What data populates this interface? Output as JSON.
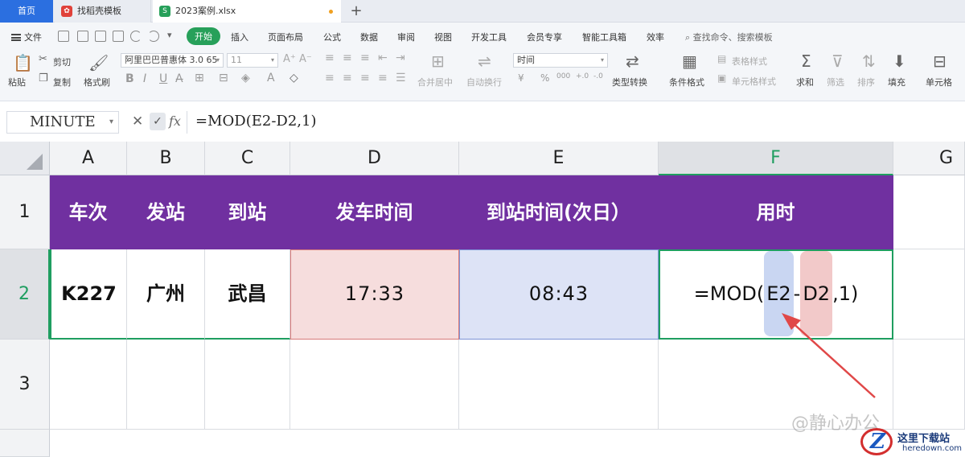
{
  "tabs": {
    "home": "首页",
    "template": "找稻壳模板",
    "file": "2023案例.xlsx",
    "add": "+"
  },
  "menu": {
    "file": "文件",
    "items": [
      "开始",
      "插入",
      "页面布局",
      "公式",
      "数据",
      "审阅",
      "视图",
      "开发工具",
      "会员专享",
      "智能工具箱",
      "效率"
    ],
    "active": "开始",
    "search": "查找命令、搜索模板"
  },
  "ribbon": {
    "paste": "粘贴",
    "cut": "剪切",
    "copy": "复制",
    "format_painter": "格式刷",
    "font_name": "阿里巴巴普惠体 3.0 65",
    "font_size": "11",
    "merge_center": "合并居中",
    "wrap_text": "自动换行",
    "number_format": "时间",
    "type_convert": "类型转换",
    "conditional_format": "条件格式",
    "table_style": "表格样式",
    "cell_style": "单元格样式",
    "sum": "求和",
    "filter": "筛选",
    "sort": "排序",
    "fill": "填充",
    "cells": "单元格"
  },
  "formula_bar": {
    "name_box": "MINUTE",
    "fx": "fx",
    "formula": "=MOD(E2-D2,1)"
  },
  "sheet": {
    "columns": [
      "A",
      "B",
      "C",
      "D",
      "E",
      "F",
      "G"
    ],
    "rows": [
      "1",
      "2",
      "3"
    ],
    "header_row": [
      "车次",
      "发站",
      "到站",
      "发车时间",
      "到站时间(次日）",
      "用时"
    ],
    "data_row": {
      "A": "K227",
      "B": "广州",
      "C": "武昌",
      "D": "17:33",
      "E": "08:43",
      "F_prefix": "=MOD(",
      "F_ref1": "E2",
      "F_minus": "-",
      "F_ref2": "D2",
      "F_suffix": ",1)"
    },
    "active_cell": "F2"
  },
  "overlay": {
    "watermark": "@静心办公",
    "site_cn": "这里下载站",
    "site_en": "heredown.com"
  },
  "colors": {
    "header_fill": "#7030a0",
    "active_border": "#1f9e60",
    "ref_e2": "#dde3f6",
    "ref_d2": "#f6dddd",
    "arrow": "#e04848"
  }
}
